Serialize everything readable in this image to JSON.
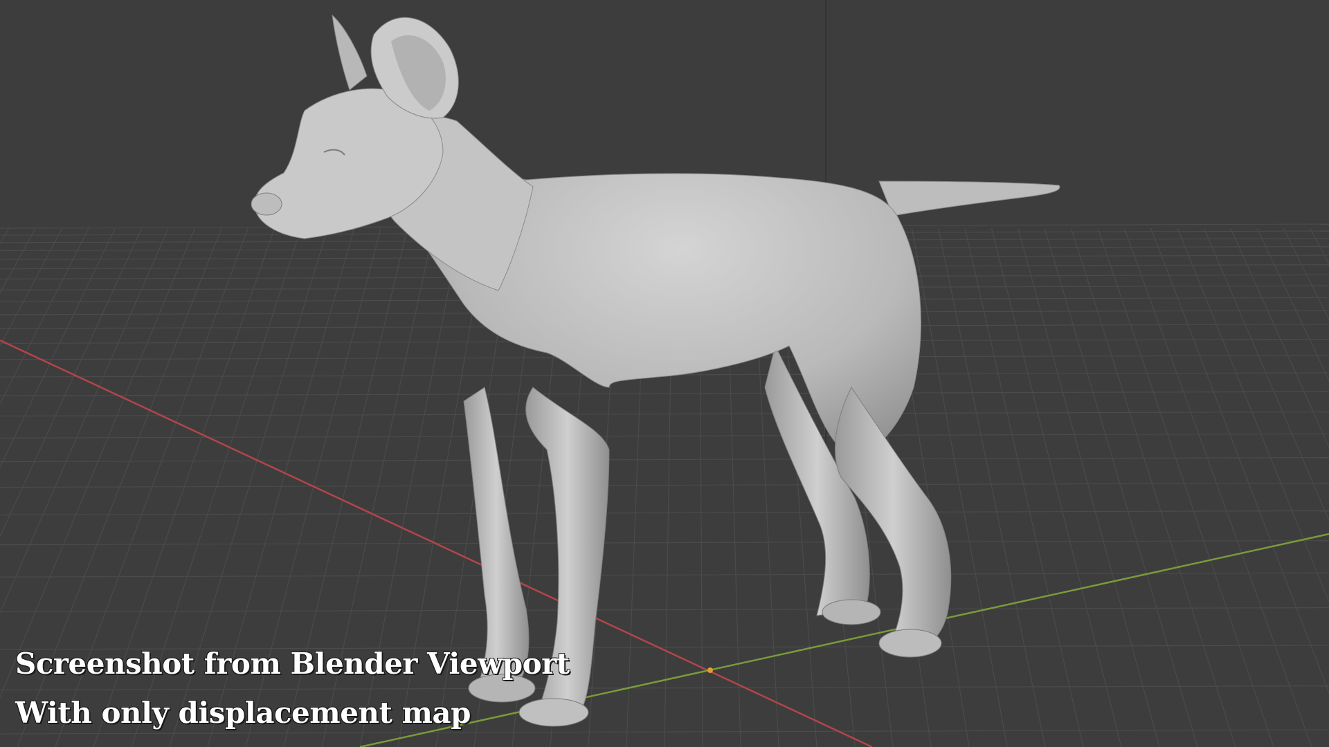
{
  "viewport": {
    "background_color": "#3d3d3d",
    "grid_color": "#4a4a4a",
    "x_axis_color": "#b3454a",
    "y_axis_color": "#7a9b3a",
    "model_color": "#c7c7c7",
    "object": "dog sculpt (displacement only)"
  },
  "caption": {
    "line1": "Screenshot from Blender Viewport",
    "line2": "With only displacement map"
  }
}
